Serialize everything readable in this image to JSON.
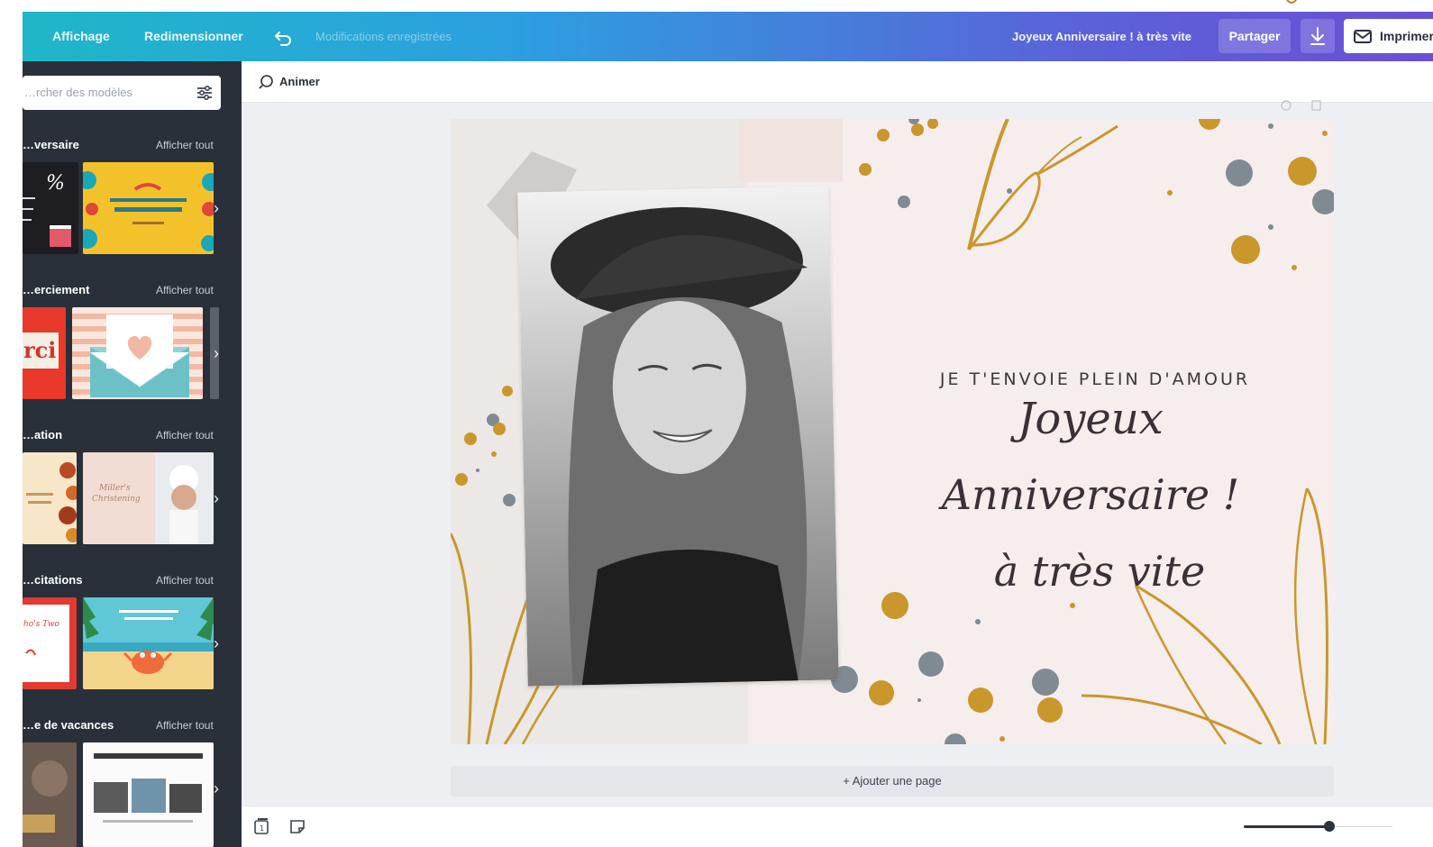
{
  "topbar": {
    "view_label": "Affichage",
    "resize_label": "Redimensionner",
    "saved_status": "Modifications enregistrées",
    "document_title": "Joyeux Anniversaire ! à très vite",
    "share_label": "Partager",
    "print_label": "Imprimer"
  },
  "sidebar": {
    "search_placeholder": "…rcher des modèles",
    "sections": [
      {
        "title": "…versaire",
        "link": "Afficher tout"
      },
      {
        "title": "…erciement",
        "link": "Afficher tout"
      },
      {
        "title": "…ation",
        "link": "Afficher tout"
      },
      {
        "title": "…citations",
        "link": "Afficher tout"
      },
      {
        "title": "…e de vacances",
        "link": "Afficher tout"
      }
    ]
  },
  "toolbar": {
    "animate_label": "Animer"
  },
  "card": {
    "headline": "JE T'ENVOIE PLEIN D'AMOUR",
    "line1": "Joyeux",
    "line2": "Anniversaire !",
    "line3": "à très vite"
  },
  "add_page_label": "+ Ajouter une page",
  "colors": {
    "gold": "#c9972c",
    "card_bg": "#f6eeec",
    "sidebar_bg": "#293039"
  }
}
